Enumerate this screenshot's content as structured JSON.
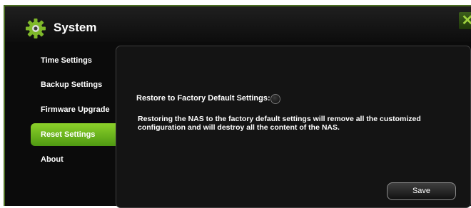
{
  "window": {
    "title": "System",
    "close_label": "✕"
  },
  "sidebar": {
    "items": [
      {
        "label": "Time Settings"
      },
      {
        "label": "Backup Settings"
      },
      {
        "label": "Firmware Upgrade"
      },
      {
        "label": "Reset Settings",
        "active": true
      },
      {
        "label": "About"
      }
    ]
  },
  "reset": {
    "restore_label": "Restore to Factory Default Settings:",
    "restore_selected": false,
    "description": "Restoring the NAS to the factory default settings will remove all the customized configuration and will destroy all the content of the NAS.",
    "save_label": "Save"
  },
  "colors": {
    "accent": "#6cb81f",
    "background": "#0b0b0b",
    "close_icon": "#9fd13e"
  },
  "icons": {
    "title": "gear-icon",
    "close": "close-icon"
  }
}
